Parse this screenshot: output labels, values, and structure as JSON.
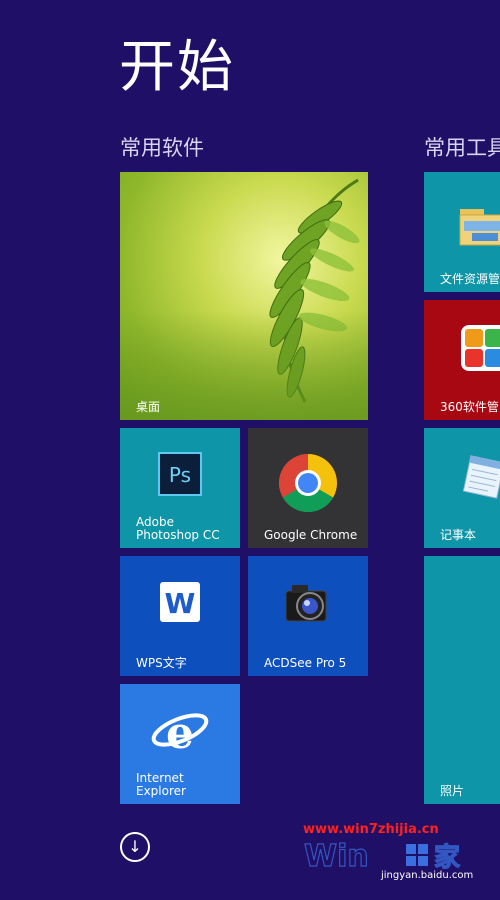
{
  "page": {
    "title": "开始"
  },
  "groups": [
    {
      "name": "常用软件"
    },
    {
      "name": "常用工具"
    }
  ],
  "tiles": {
    "desktop": {
      "label": "桌面",
      "color": "#86b22a"
    },
    "photoshop": {
      "label": "Adobe\nPhotoshop CC",
      "color": "#0e95a7",
      "icon": "photoshop-icon"
    },
    "chrome": {
      "label": "Google Chrome",
      "color": "#333336",
      "icon": "chrome-icon"
    },
    "wps": {
      "label": "WPS文字",
      "color": "#0d4fbd",
      "icon": "wps-icon"
    },
    "acdsee": {
      "label": "ACDSee Pro 5",
      "color": "#0d4fbd",
      "icon": "camera-icon"
    },
    "ie": {
      "label": "Internet\nExplorer",
      "color": "#2b7ae4",
      "icon": "ie-icon"
    },
    "explorer": {
      "label": "文件资源管",
      "color": "#0e95a7",
      "icon": "folder-icon"
    },
    "software360": {
      "label": "360软件管",
      "color": "#a80812",
      "icon": "360-icon"
    },
    "notepad": {
      "label": "记事本",
      "color": "#0e95a7",
      "icon": "notepad-icon"
    },
    "photos": {
      "label": "照片",
      "color": "#0e95a7"
    }
  },
  "watermark": {
    "url": "www.win7zhijia.cn",
    "sub": "jingyan.baidu.com"
  },
  "all_apps": {
    "icon": "down-arrow-icon"
  }
}
